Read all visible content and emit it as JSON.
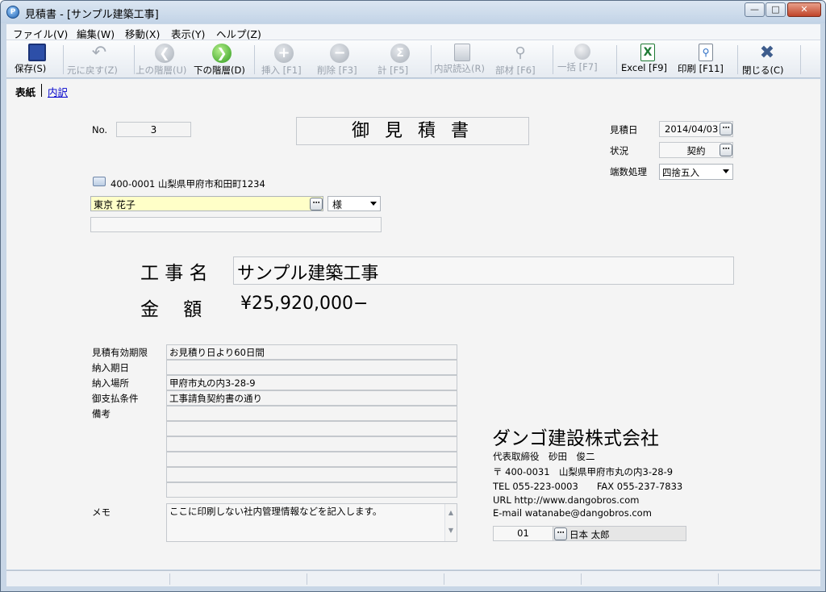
{
  "window": {
    "title": "見積書 - [サンプル建築工事]",
    "app_icon_letter": "P"
  },
  "menu": [
    "ファイル(V)",
    "編集(W)",
    "移動(X)",
    "表示(Y)",
    "ヘルプ(Z)"
  ],
  "toolbar": {
    "save": "保存(S)",
    "undo": "元に戻す(Z)",
    "up_level": "上の階層(U)",
    "down_level": "下の階層(D)",
    "insert": "挿入 [F1]",
    "delete": "削除 [F3]",
    "total": "計 [F5]",
    "load_detail": "内訳読込(R)",
    "parts": "部材 [F6]",
    "bulk": "一括 [F7]",
    "excel": "Excel [F9]",
    "print": "印刷 [F11]",
    "close": "閉じる(C)"
  },
  "tabs": {
    "cover": "表紙",
    "detail": "内訳"
  },
  "doc": {
    "no_label": "No.",
    "no_value": "3",
    "heading": "御 見 積 書",
    "date_label": "見積日",
    "date_value": "2014/04/03",
    "status_label": "状況",
    "status_value": "契約",
    "rounding_label": "端数処理",
    "rounding_value": "四捨五入",
    "client_address": "400-0001 山梨県甲府市和田町1234",
    "client_name": "東京 花子",
    "honorific": "様",
    "project_label": "工 事 名",
    "project_name": "サンプル建築工事",
    "amount_label": "金　 額",
    "amount_value": "¥25,920,000−"
  },
  "conditions": {
    "validity_label": "見積有効期限",
    "validity_value": "お見積り日より60日間",
    "delivery_date_label": "納入期日",
    "delivery_date_value": "",
    "delivery_place_label": "納入場所",
    "delivery_place_value": "甲府市丸の内3-28-9",
    "payment_label": "御支払条件",
    "payment_value": "工事請負契約書の通り",
    "remarks_label": "備考",
    "memo_label": "メモ",
    "memo_value": "ここに印刷しない社内管理情報などを記入します。"
  },
  "company": {
    "name": "ダンゴ建設株式会社",
    "representative": "代表取締役　砂田　俊二",
    "address": "〒 400-0031　山梨県甲府市丸の内3-28-9",
    "tel_fax": "TEL  055-223-0003　　FAX  055-237-7833",
    "url": "URL  http://www.dangobros.com",
    "email": "E-mail  watanabe@dangobros.com",
    "staff_code": "01",
    "staff_name": "日本  太郎"
  },
  "colors": {
    "client_field_bg": "#ffffc8",
    "title_gradient_top": "#dbe6f2"
  }
}
